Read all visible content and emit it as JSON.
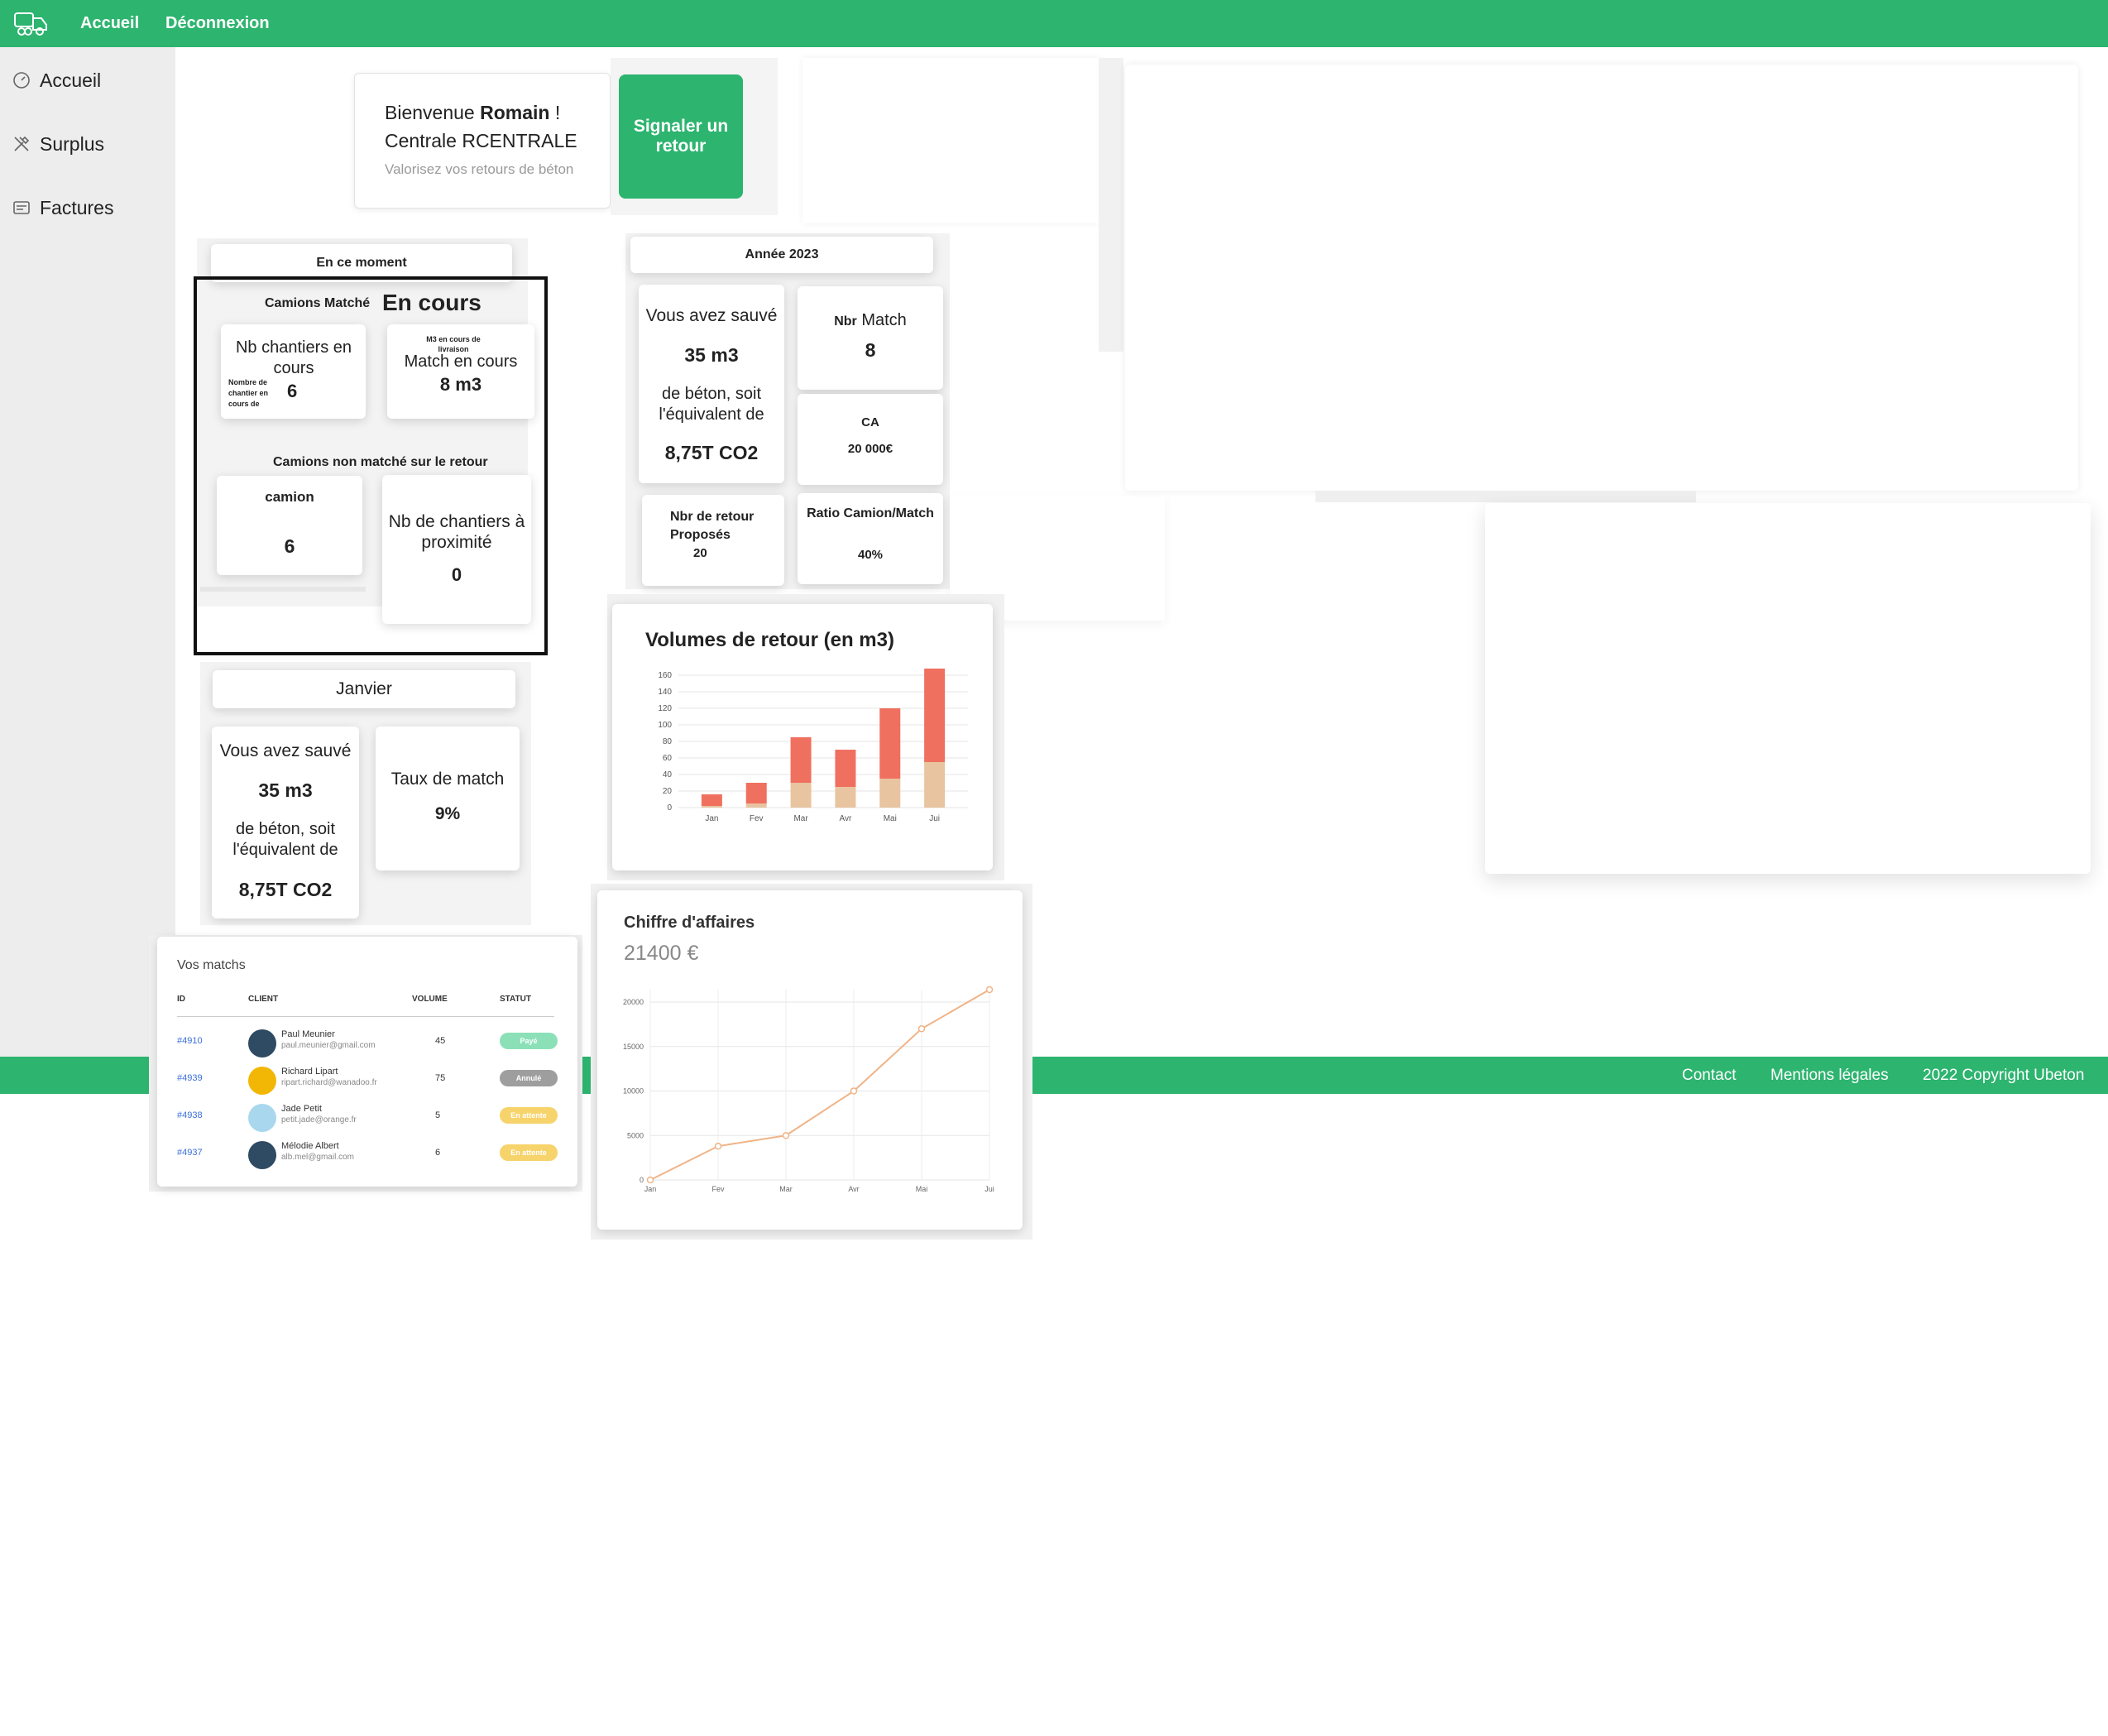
{
  "topbar": {
    "nav": [
      "Accueil",
      "Déconnexion"
    ]
  },
  "sidebar": {
    "items": [
      {
        "label": "Accueil",
        "icon": "dashboard-icon"
      },
      {
        "label": "Surplus",
        "icon": "tools-icon"
      },
      {
        "label": "Factures",
        "icon": "invoice-icon"
      }
    ]
  },
  "welcome": {
    "hello": "Bienvenue",
    "name": "Romain",
    "excl": "!",
    "centrale_label": "Centrale",
    "centrale": "RCENTRALE",
    "tagline": "Valorisez vos retours de béton",
    "report_button": "Signaler un retour"
  },
  "now": {
    "header": "En ce moment",
    "matched_label": "Camions Matché",
    "in_progress": "En cours",
    "sites_title": "Nb chantiers en cours",
    "sites_small": "Nombre de chantier en cours de",
    "sites_value": "6",
    "m3_small": "M3 en cours de livraison",
    "m3_title": "Match en cours",
    "m3_value": "8 m3",
    "unmatched_label_a": "Camions",
    "unmatched_label_b": "non matché sur le retour",
    "truck_title": "camion",
    "truck_value": "6",
    "nearby_title": "Nb de chantiers à proximité",
    "nearby_value": "0"
  },
  "year": {
    "header": "Année 2023",
    "saved_title": "Vous avez sauvé",
    "saved_value": "35 m3",
    "saved_text": "de béton, soit l'équivalent de",
    "saved_co2": "8,75T CO2",
    "match_label_a": "Nbr",
    "match_label_b": "Match",
    "match_value": "8",
    "ca_label": "CA",
    "ca_value": "20 000€",
    "returns_label": "Nbr de retour Proposés",
    "returns_value": "20",
    "ratio_label": "Ratio Camion/Match",
    "ratio_value": "40%"
  },
  "month": {
    "header": "Janvier",
    "saved_title": "Vous avez sauvé",
    "saved_value": "35 m3",
    "saved_text": "de béton, soit l'équivalent de",
    "saved_co2": "8,75T CO2",
    "rate_title": "Taux de match",
    "rate_value": "9%"
  },
  "matches": {
    "title": "Vos matchs",
    "columns": [
      "ID",
      "CLIENT",
      "VOLUME",
      "STATUT"
    ],
    "rows": [
      {
        "id": "#4910",
        "name": "Paul Meunier",
        "email": "paul.meunier@gmail.com",
        "volume": "45",
        "status": "Payé",
        "status_color": "#8be0b8",
        "avatar_color": "#2f4a63"
      },
      {
        "id": "#4939",
        "name": "Richard Lipart",
        "email": "ripart.richard@wanadoo.fr",
        "volume": "75",
        "status": "Annulé",
        "status_color": "#9e9e9e",
        "avatar_color": "#f2b705"
      },
      {
        "id": "#4938",
        "name": "Jade Petit",
        "email": "petit.jade@orange.fr",
        "volume": "5",
        "status": "En attente",
        "status_color": "#f7d36b",
        "avatar_color": "#a9d7ee"
      },
      {
        "id": "#4937",
        "name": "Mélodie Albert",
        "email": "alb.mel@gmail.com",
        "volume": "6",
        "status": "En attente",
        "status_color": "#f7d36b",
        "avatar_color": "#2f4a63"
      }
    ]
  },
  "footer": {
    "links": [
      "Contact",
      "Mentions légales",
      "2022 Copyright Ubeton"
    ]
  },
  "chart_data": [
    {
      "type": "bar",
      "title": "Volumes de retour (en m3)",
      "categories": [
        "Jan",
        "Fev",
        "Mar",
        "Avr",
        "Mai",
        "Jui"
      ],
      "series": [
        {
          "values": [
            2,
            5,
            30,
            25,
            35,
            55
          ],
          "color": "#e8c4a0"
        },
        {
          "values": [
            14,
            25,
            55,
            45,
            85,
            113
          ],
          "color": "#f07060"
        }
      ],
      "stacked": true,
      "ylim": [
        0,
        160
      ],
      "yticks": [
        0,
        20,
        40,
        60,
        80,
        100,
        120,
        140,
        160
      ],
      "grid": true
    },
    {
      "type": "line",
      "title": "Chiffre d'affaires",
      "subtitle": "21400 €",
      "categories": [
        "Jan",
        "Fev",
        "Mar",
        "Avr",
        "Mai",
        "Jui"
      ],
      "series": [
        {
          "values": [
            0,
            3800,
            5000,
            10000,
            17000,
            21400
          ],
          "color": "#f0b488"
        }
      ],
      "ylim": [
        0,
        21400
      ],
      "yticks": [
        0,
        5000,
        10000,
        15000,
        20000
      ],
      "grid": true
    }
  ]
}
